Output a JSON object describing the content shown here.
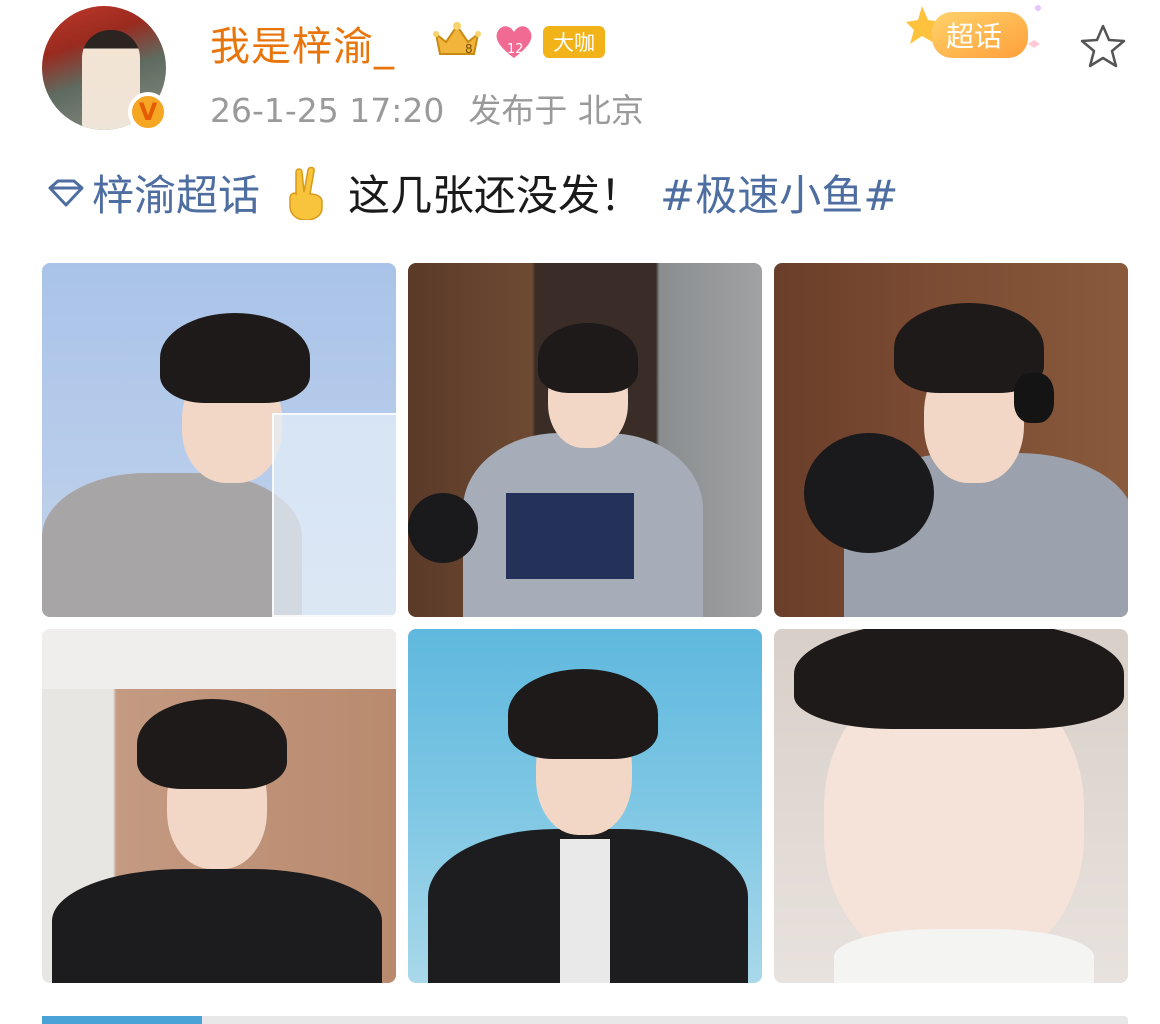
{
  "post": {
    "username": "我是梓渝_",
    "crown_badge_level": "8",
    "heart_badge_level": "12",
    "daka_label": "大咖",
    "timestamp": "26-1-25 17:20",
    "location": "发布于 北京",
    "supertopic_label": "超话",
    "content": {
      "supertopic_link": "梓渝超话",
      "text": "这几张还没发！",
      "hashtag": "#极速小鱼#"
    },
    "images": [
      {
        "desc": "photo-1"
      },
      {
        "desc": "photo-2"
      },
      {
        "desc": "photo-3"
      },
      {
        "desc": "photo-4"
      },
      {
        "desc": "photo-5"
      },
      {
        "desc": "photo-6"
      }
    ]
  },
  "colors": {
    "username": "#e8750c",
    "meta": "#9a9a9a",
    "link": "#4e6ea1",
    "daka_badge": "#f2b318"
  },
  "icons": {
    "verified": "verified-v-icon",
    "star": "star-outline-icon",
    "gem": "supertopic-gem-icon",
    "emoji": "peace-sign-emoji"
  }
}
